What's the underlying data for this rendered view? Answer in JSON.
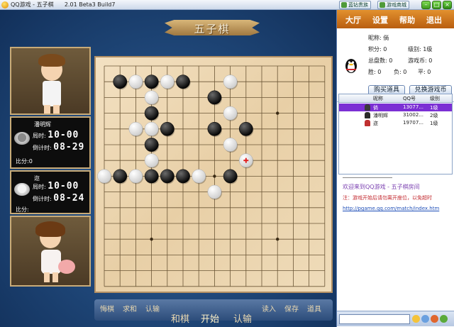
{
  "window": {
    "title": "QQ游戏 - 五子棋",
    "version": "2.01 Beta3 Build7",
    "mall_buttons": [
      "蓝钻贵族",
      "游戏商城"
    ]
  },
  "game": {
    "banner_title": "五子棋",
    "players": [
      {
        "name": "潘明辉",
        "stone": "black",
        "time_label": "局时:",
        "time_value": "10-00",
        "countdown_label": "倒计时:",
        "countdown_value": "08-29",
        "score_label": "比分:0"
      },
      {
        "name": "迩",
        "stone": "white",
        "time_label": "局时:",
        "time_value": "10-00",
        "countdown_label": "倒计时:",
        "countdown_value": "08-24",
        "score_label": "比分:"
      }
    ],
    "board": {
      "size": 15,
      "star_points": [
        [
          3,
          3
        ],
        [
          11,
          3
        ],
        [
          3,
          11
        ],
        [
          11,
          11
        ],
        [
          7,
          7
        ]
      ],
      "last_move": [
        9,
        6
      ],
      "stones": [
        {
          "c": 1,
          "r": 1,
          "color": "black"
        },
        {
          "c": 2,
          "r": 1,
          "color": "white"
        },
        {
          "c": 3,
          "r": 1,
          "color": "black"
        },
        {
          "c": 4,
          "r": 1,
          "color": "white"
        },
        {
          "c": 5,
          "r": 1,
          "color": "black"
        },
        {
          "c": 8,
          "r": 1,
          "color": "white"
        },
        {
          "c": 3,
          "r": 2,
          "color": "white"
        },
        {
          "c": 7,
          "r": 2,
          "color": "black"
        },
        {
          "c": 3,
          "r": 3,
          "color": "black"
        },
        {
          "c": 8,
          "r": 3,
          "color": "white"
        },
        {
          "c": 2,
          "r": 4,
          "color": "white"
        },
        {
          "c": 3,
          "r": 4,
          "color": "white"
        },
        {
          "c": 4,
          "r": 4,
          "color": "black"
        },
        {
          "c": 7,
          "r": 4,
          "color": "black"
        },
        {
          "c": 9,
          "r": 4,
          "color": "black"
        },
        {
          "c": 3,
          "r": 5,
          "color": "black"
        },
        {
          "c": 8,
          "r": 5,
          "color": "white"
        },
        {
          "c": 3,
          "r": 6,
          "color": "white"
        },
        {
          "c": 9,
          "r": 6,
          "color": "white"
        },
        {
          "c": 0,
          "r": 7,
          "color": "white"
        },
        {
          "c": 1,
          "r": 7,
          "color": "black"
        },
        {
          "c": 2,
          "r": 7,
          "color": "white"
        },
        {
          "c": 3,
          "r": 7,
          "color": "black"
        },
        {
          "c": 4,
          "r": 7,
          "color": "black"
        },
        {
          "c": 5,
          "r": 7,
          "color": "black"
        },
        {
          "c": 6,
          "r": 7,
          "color": "white"
        },
        {
          "c": 8,
          "r": 7,
          "color": "black"
        },
        {
          "c": 7,
          "r": 8,
          "color": "white"
        }
      ]
    },
    "bottom_buttons": {
      "left_small": [
        "悔棋",
        "求和",
        "认输"
      ],
      "left_big": [
        "和棋",
        "开始",
        "认输"
      ],
      "right_small": [
        "读入",
        "保存",
        "道具"
      ]
    }
  },
  "sidebar": {
    "menu": [
      "大厅",
      "设置",
      "帮助",
      "退出"
    ],
    "user": {
      "nickname": "昵称: 倘",
      "points": "积分: 0",
      "level": "级别: 1级",
      "total_games": "总盘数: 0",
      "coins": "游戏币: 0",
      "wins": "胜: 0",
      "losses": "负: 0",
      "draws": "平: 0"
    },
    "buttons": [
      "购买道具",
      "兑换游戏币"
    ],
    "table_headers": [
      "昵称",
      "QQ号",
      "级别"
    ],
    "table_rows": [
      {
        "name": "倘",
        "qq": "13077...",
        "level": "1级",
        "selected": true,
        "icon_color": "#3a3a3a"
      },
      {
        "name": "潘明辉",
        "qq": "31002...",
        "level": "2级",
        "selected": false,
        "icon_color": "#2a2a2a"
      },
      {
        "name": "迩",
        "qq": "19707...",
        "level": "1级",
        "selected": false,
        "icon_color": "#c03030"
      }
    ],
    "chat_lines": [
      {
        "text": "欢迎来到QQ游戏 - 五子棋房间",
        "color": "#7a3fb0"
      },
      {
        "text": "注：游戏开始后请勿离开座位，以免超时",
        "color": "#c2272d"
      },
      {
        "text": "http://pgame.qq.com/match/index.htm",
        "color": "#1f4fb8"
      }
    ]
  }
}
